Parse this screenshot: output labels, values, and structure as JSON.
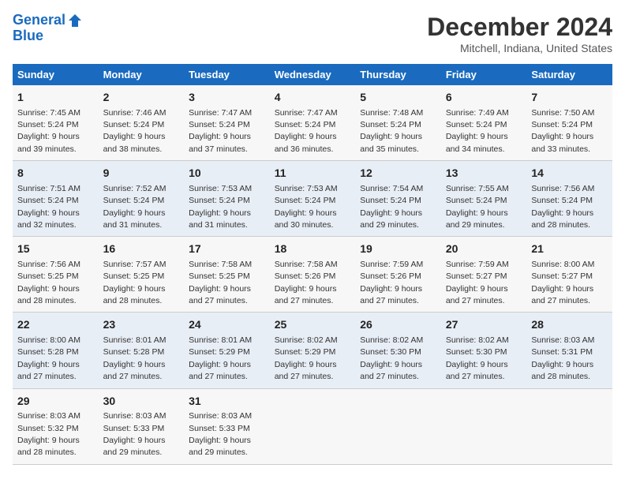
{
  "logo": {
    "line1": "General",
    "line2": "Blue"
  },
  "title": "December 2024",
  "location": "Mitchell, Indiana, United States",
  "days_of_week": [
    "Sunday",
    "Monday",
    "Tuesday",
    "Wednesday",
    "Thursday",
    "Friday",
    "Saturday"
  ],
  "weeks": [
    [
      {
        "day": 1,
        "info": "Sunrise: 7:45 AM\nSunset: 5:24 PM\nDaylight: 9 hours\nand 39 minutes."
      },
      {
        "day": 2,
        "info": "Sunrise: 7:46 AM\nSunset: 5:24 PM\nDaylight: 9 hours\nand 38 minutes."
      },
      {
        "day": 3,
        "info": "Sunrise: 7:47 AM\nSunset: 5:24 PM\nDaylight: 9 hours\nand 37 minutes."
      },
      {
        "day": 4,
        "info": "Sunrise: 7:47 AM\nSunset: 5:24 PM\nDaylight: 9 hours\nand 36 minutes."
      },
      {
        "day": 5,
        "info": "Sunrise: 7:48 AM\nSunset: 5:24 PM\nDaylight: 9 hours\nand 35 minutes."
      },
      {
        "day": 6,
        "info": "Sunrise: 7:49 AM\nSunset: 5:24 PM\nDaylight: 9 hours\nand 34 minutes."
      },
      {
        "day": 7,
        "info": "Sunrise: 7:50 AM\nSunset: 5:24 PM\nDaylight: 9 hours\nand 33 minutes."
      }
    ],
    [
      {
        "day": 8,
        "info": "Sunrise: 7:51 AM\nSunset: 5:24 PM\nDaylight: 9 hours\nand 32 minutes."
      },
      {
        "day": 9,
        "info": "Sunrise: 7:52 AM\nSunset: 5:24 PM\nDaylight: 9 hours\nand 31 minutes."
      },
      {
        "day": 10,
        "info": "Sunrise: 7:53 AM\nSunset: 5:24 PM\nDaylight: 9 hours\nand 31 minutes."
      },
      {
        "day": 11,
        "info": "Sunrise: 7:53 AM\nSunset: 5:24 PM\nDaylight: 9 hours\nand 30 minutes."
      },
      {
        "day": 12,
        "info": "Sunrise: 7:54 AM\nSunset: 5:24 PM\nDaylight: 9 hours\nand 29 minutes."
      },
      {
        "day": 13,
        "info": "Sunrise: 7:55 AM\nSunset: 5:24 PM\nDaylight: 9 hours\nand 29 minutes."
      },
      {
        "day": 14,
        "info": "Sunrise: 7:56 AM\nSunset: 5:24 PM\nDaylight: 9 hours\nand 28 minutes."
      }
    ],
    [
      {
        "day": 15,
        "info": "Sunrise: 7:56 AM\nSunset: 5:25 PM\nDaylight: 9 hours\nand 28 minutes."
      },
      {
        "day": 16,
        "info": "Sunrise: 7:57 AM\nSunset: 5:25 PM\nDaylight: 9 hours\nand 28 minutes."
      },
      {
        "day": 17,
        "info": "Sunrise: 7:58 AM\nSunset: 5:25 PM\nDaylight: 9 hours\nand 27 minutes."
      },
      {
        "day": 18,
        "info": "Sunrise: 7:58 AM\nSunset: 5:26 PM\nDaylight: 9 hours\nand 27 minutes."
      },
      {
        "day": 19,
        "info": "Sunrise: 7:59 AM\nSunset: 5:26 PM\nDaylight: 9 hours\nand 27 minutes."
      },
      {
        "day": 20,
        "info": "Sunrise: 7:59 AM\nSunset: 5:27 PM\nDaylight: 9 hours\nand 27 minutes."
      },
      {
        "day": 21,
        "info": "Sunrise: 8:00 AM\nSunset: 5:27 PM\nDaylight: 9 hours\nand 27 minutes."
      }
    ],
    [
      {
        "day": 22,
        "info": "Sunrise: 8:00 AM\nSunset: 5:28 PM\nDaylight: 9 hours\nand 27 minutes."
      },
      {
        "day": 23,
        "info": "Sunrise: 8:01 AM\nSunset: 5:28 PM\nDaylight: 9 hours\nand 27 minutes."
      },
      {
        "day": 24,
        "info": "Sunrise: 8:01 AM\nSunset: 5:29 PM\nDaylight: 9 hours\nand 27 minutes."
      },
      {
        "day": 25,
        "info": "Sunrise: 8:02 AM\nSunset: 5:29 PM\nDaylight: 9 hours\nand 27 minutes."
      },
      {
        "day": 26,
        "info": "Sunrise: 8:02 AM\nSunset: 5:30 PM\nDaylight: 9 hours\nand 27 minutes."
      },
      {
        "day": 27,
        "info": "Sunrise: 8:02 AM\nSunset: 5:30 PM\nDaylight: 9 hours\nand 27 minutes."
      },
      {
        "day": 28,
        "info": "Sunrise: 8:03 AM\nSunset: 5:31 PM\nDaylight: 9 hours\nand 28 minutes."
      }
    ],
    [
      {
        "day": 29,
        "info": "Sunrise: 8:03 AM\nSunset: 5:32 PM\nDaylight: 9 hours\nand 28 minutes."
      },
      {
        "day": 30,
        "info": "Sunrise: 8:03 AM\nSunset: 5:33 PM\nDaylight: 9 hours\nand 29 minutes."
      },
      {
        "day": 31,
        "info": "Sunrise: 8:03 AM\nSunset: 5:33 PM\nDaylight: 9 hours\nand 29 minutes."
      },
      null,
      null,
      null,
      null
    ]
  ]
}
